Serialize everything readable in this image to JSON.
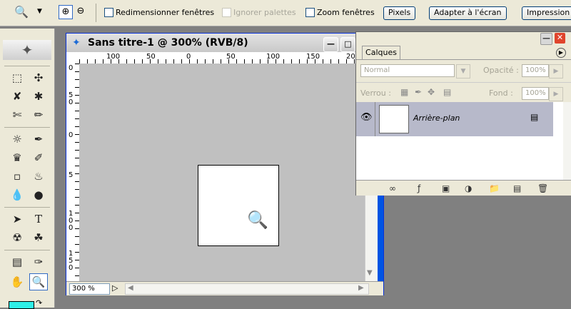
{
  "options": {
    "resize_windows": "Redimensionner fenêtres",
    "ignore_palettes": "Ignorer palettes",
    "zoom_windows": "Zoom fenêtres",
    "pixels_btn": "Pixels",
    "fit_screen_btn": "Adapter à l'écran",
    "print_btn": "Impression"
  },
  "document": {
    "title": "Sans titre-1 @ 300% (RVB/8)",
    "zoom": "300 %",
    "hruler_labels": [
      "100",
      "50",
      "0",
      "50",
      "100",
      "150",
      "200"
    ],
    "vruler_labels": [
      "0",
      "5\n0",
      "0",
      "5",
      "1\n0\n0",
      "1\n5\n0"
    ]
  },
  "layers": {
    "tab": "Calques",
    "blend_mode": "Normal",
    "opacity_label": "Opacité :",
    "opacity_value": "100%",
    "lock_label": "Verrou :",
    "fill_label": "Fond :",
    "fill_value": "100%",
    "layer_name": "Arrière-plan"
  },
  "colors": {
    "accent": "#316ac5",
    "layer_selected": "#b7b9ca",
    "close_red": "#e0442c"
  }
}
